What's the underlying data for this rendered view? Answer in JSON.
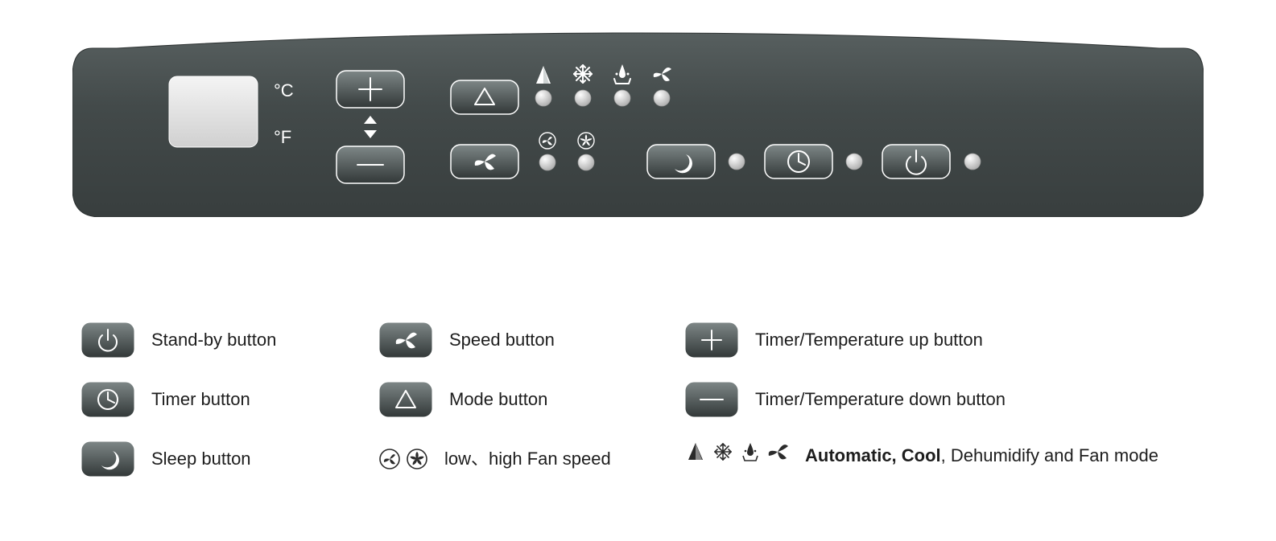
{
  "panel": {
    "units": {
      "celsius": "°C",
      "fahrenheit": "°F"
    }
  },
  "legend": {
    "standby": "Stand-by button",
    "timer": "Timer button",
    "sleep": "Sleep button",
    "speed": "Speed button",
    "mode": "Mode button",
    "fan_speed": "low、high Fan speed",
    "up": "Timer/Temperature up button",
    "down": "Timer/Temperature down button",
    "modes_bold": "Automatic, Cool",
    "modes_rest": ", Dehumidify   and  Fan mode"
  }
}
